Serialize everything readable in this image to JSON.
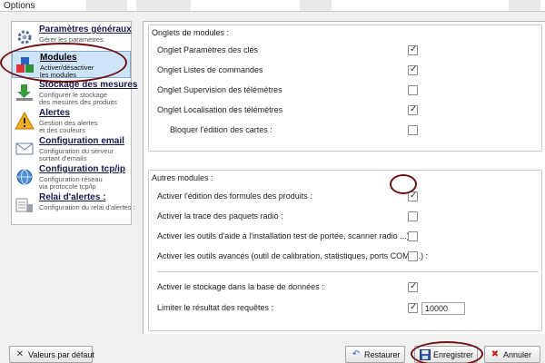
{
  "window": {
    "title": "Options"
  },
  "sidebar": {
    "items": [
      {
        "title": "Paramètres généraux",
        "line1": "Gérer les paramètres",
        "line2": "",
        "icon": "gear-icon",
        "selected": false
      },
      {
        "title": "Modules",
        "line1": "Activer/désactiver",
        "line2": "les modules",
        "icon": "modules-blocks-icon",
        "selected": true
      },
      {
        "title": "Stockage des mesures",
        "line1": "Configurer le stockage",
        "line2": "des mesures des produits",
        "icon": "download-arrow-icon",
        "selected": false
      },
      {
        "title": "Alertes",
        "line1": "Gestion des alertes",
        "line2": "et des couleurs",
        "icon": "alert-triangle-icon",
        "selected": false
      },
      {
        "title": "Configuration email",
        "line1": "Configuration du serveur",
        "line2": "sortant d'emails",
        "icon": "email-icon",
        "selected": false
      },
      {
        "title": "Configuration tcp/ip",
        "line1": "Configuration réseau",
        "line2": "via protocole tcp/ip",
        "icon": "network-globe-icon",
        "selected": false
      },
      {
        "title": "Relai d'alertes :",
        "line1": "Configuration du relai d'alertes :",
        "line2": "",
        "icon": "relay-alerts-icon",
        "selected": false
      }
    ]
  },
  "onglets": {
    "title": "Onglets de modules :",
    "rows": [
      {
        "label": "Onglet Paramètres des clés",
        "checked": true
      },
      {
        "label": "Onglet Listes de commandes",
        "checked": true
      },
      {
        "label": "Onglet Supervision des télémètres",
        "checked": false
      },
      {
        "label": "Onglet Localisation des télémètres",
        "checked": true
      },
      {
        "label": "Bloquer l'édition des cartes :",
        "checked": false
      }
    ]
  },
  "autres": {
    "title": "Autres modules :",
    "rows": [
      {
        "label": "Activer l'édition des formules des produits :",
        "checked": true
      },
      {
        "label": "Activer la trace des paquets radio :",
        "checked": false
      },
      {
        "label": "Activer les outils d'aide à l'installation test de portée, scanner radio ...) :",
        "checked": false
      },
      {
        "label": "Activer les outils avancés (outil de calibration, statistiques, ports COM, ...) :",
        "checked": false
      },
      {
        "label": "Activer le stockage dans la base de données :",
        "checked": true
      },
      {
        "label": "Limiter le résultat des requêtes :",
        "checked": true
      }
    ],
    "limit_value": "10000"
  },
  "buttons": {
    "defaults": {
      "label": "Valeurs par défaut",
      "icon": "close-x-icon"
    },
    "restore": {
      "label": "Restaurer",
      "icon": "undo-arrow-icon"
    },
    "save": {
      "label": "Enregistrer",
      "icon": "floppy-disk-icon"
    },
    "cancel": {
      "label": "Annuler",
      "icon": "cancel-x-icon"
    }
  },
  "colors": {
    "annotation_oval": "#6e1216",
    "selected_bg": "#cde3f8",
    "cancel_red": "#cc1f1f"
  }
}
